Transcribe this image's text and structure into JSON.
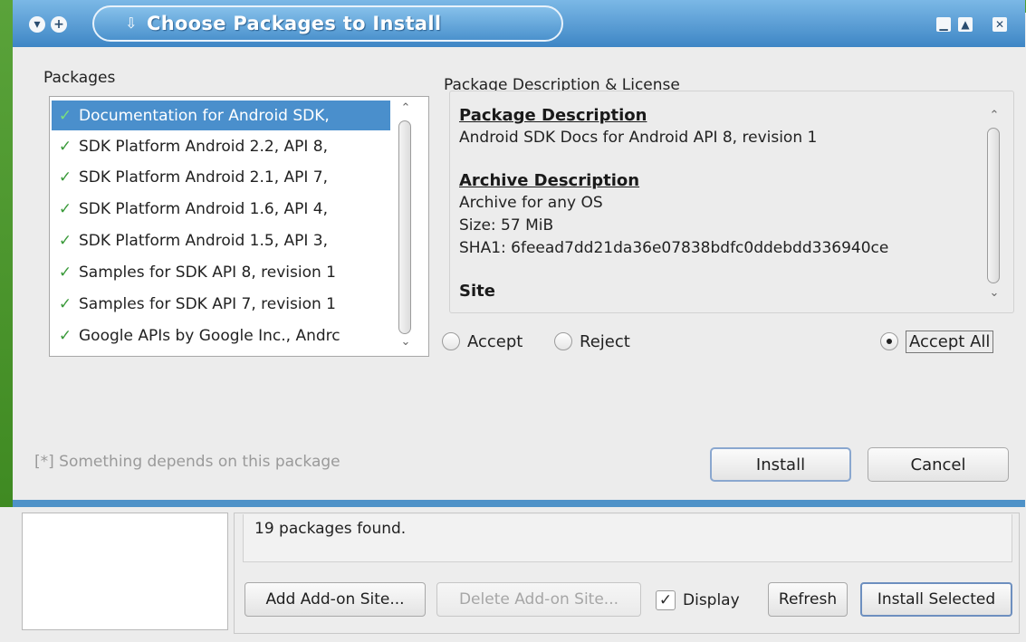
{
  "dialog": {
    "title": "Choose Packages to Install",
    "packages_label": "Packages",
    "description_group_label": "Package Description & License",
    "packages": [
      {
        "label": "Documentation for Android SDK,",
        "selected": true
      },
      {
        "label": "SDK Platform Android 2.2, API 8,",
        "selected": false
      },
      {
        "label": "SDK Platform Android 2.1, API 7,",
        "selected": false
      },
      {
        "label": "SDK Platform Android 1.6, API 4,",
        "selected": false
      },
      {
        "label": "SDK Platform Android 1.5, API 3,",
        "selected": false
      },
      {
        "label": "Samples for SDK API 8, revision 1",
        "selected": false
      },
      {
        "label": "Samples for SDK API 7, revision 1",
        "selected": false
      },
      {
        "label": "Google APIs by Google Inc., Andrc",
        "selected": false
      }
    ],
    "description": {
      "package_heading": "Package Description",
      "package_text": "Android SDK Docs for Android API 8, revision 1",
      "archive_heading": "Archive Description",
      "archive_os": "Archive for any OS",
      "archive_size": "Size: 57 MiB",
      "archive_sha1": "SHA1: 6feead7dd21da36e07838bdfc0ddebdd336940ce",
      "site_heading": "Site"
    },
    "radios": {
      "accept": "Accept",
      "reject": "Reject",
      "accept_all": "Accept All",
      "selected": "accept_all"
    },
    "footnote": "[*] Something depends on this package",
    "install_label": "Install",
    "cancel_label": "Cancel"
  },
  "background": {
    "status_text": "19 packages found.",
    "add_site_label": "Add Add-on Site...",
    "delete_site_label": "Delete Add-on Site...",
    "display_label": "Display",
    "display_checked": true,
    "refresh_label": "Refresh",
    "install_selected_label": "Install Selected"
  },
  "colors": {
    "titlebar": "#3e86c5",
    "selection": "#4a8fcc",
    "check_green": "#3a9a3a",
    "frame_green": "#4f9b31"
  }
}
